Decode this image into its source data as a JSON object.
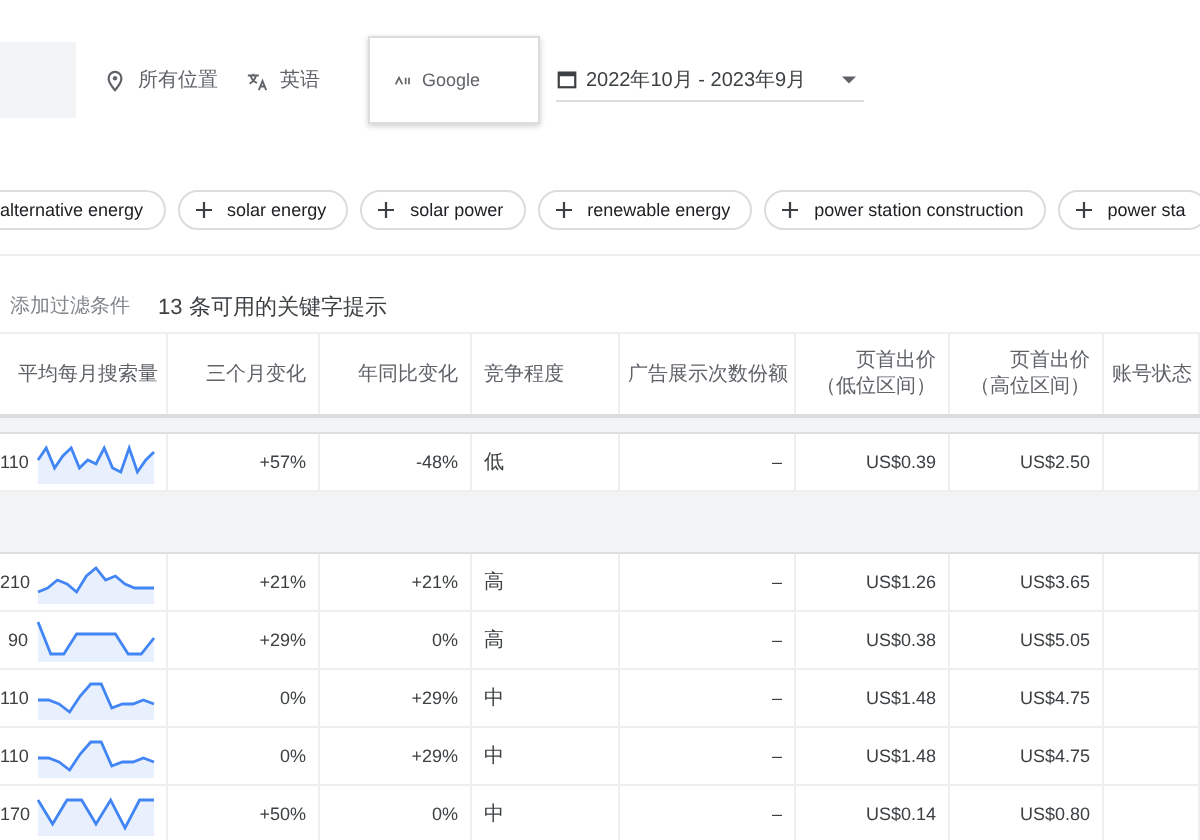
{
  "toolbar": {
    "location": "所有位置",
    "language": "英语",
    "network": "Google",
    "date_range": "2022年10月 - 2023年9月"
  },
  "suggestions": [
    {
      "label": "alternative energy",
      "cut": true
    },
    {
      "label": "solar energy",
      "cut": false
    },
    {
      "label": "solar power",
      "cut": false
    },
    {
      "label": "renewable energy",
      "cut": false
    },
    {
      "label": "power station construction",
      "cut": false
    },
    {
      "label": "power sta",
      "cut": false
    }
  ],
  "filter": {
    "add_filter": "添加过滤条件",
    "count": "13 条可用的关键字提示"
  },
  "table": {
    "columns": [
      "平均每月搜索量",
      "三个月变化",
      "年同比变化",
      "竞争程度",
      "广告展示次数份额",
      "页首出价（低位区间）",
      "页首出价（高位区间）",
      "账号状态"
    ],
    "groups": [
      {
        "rows": [
          {
            "volume": "110",
            "three_month": "+57%",
            "yoy": "-48%",
            "competition": "低",
            "impression_share": "–",
            "bid_low": "US$0.39",
            "bid_high": "US$2.50"
          }
        ]
      },
      {
        "rows": [
          {
            "volume": "210",
            "three_month": "+21%",
            "yoy": "+21%",
            "competition": "高",
            "impression_share": "–",
            "bid_low": "US$1.26",
            "bid_high": "US$3.65"
          },
          {
            "volume": "90",
            "three_month": "+29%",
            "yoy": "0%",
            "competition": "高",
            "impression_share": "–",
            "bid_low": "US$0.38",
            "bid_high": "US$5.05"
          },
          {
            "volume": "110",
            "three_month": "0%",
            "yoy": "+29%",
            "competition": "中",
            "impression_share": "–",
            "bid_low": "US$1.48",
            "bid_high": "US$4.75"
          },
          {
            "volume": "110",
            "three_month": "0%",
            "yoy": "+29%",
            "competition": "中",
            "impression_share": "–",
            "bid_low": "US$1.48",
            "bid_high": "US$4.75"
          },
          {
            "volume": "170",
            "three_month": "+50%",
            "yoy": "0%",
            "competition": "中",
            "impression_share": "–",
            "bid_low": "US$0.14",
            "bid_high": "US$0.80"
          }
        ]
      }
    ]
  }
}
